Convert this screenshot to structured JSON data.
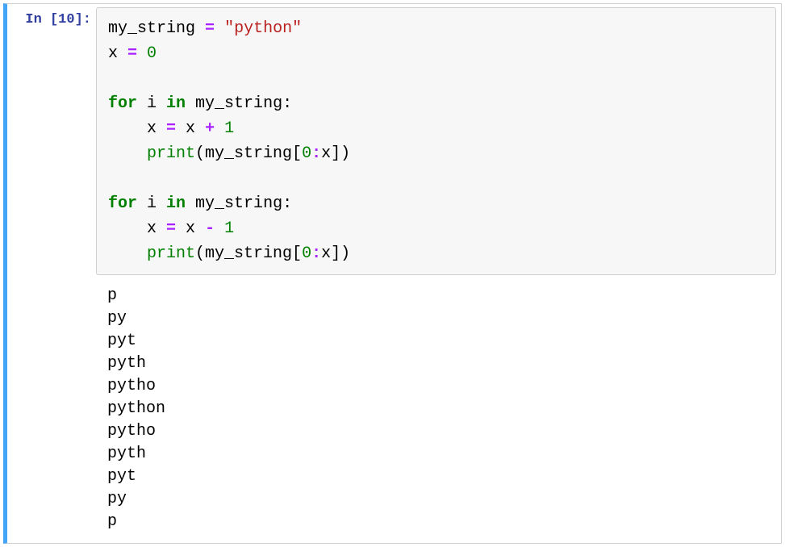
{
  "cell": {
    "prompt_label": "In [10]:",
    "code": {
      "l1": {
        "a": "my_string ",
        "op": "=",
        "b": " ",
        "str": "\"python\""
      },
      "l2": {
        "a": "x ",
        "op": "=",
        "b": " ",
        "num": "0"
      },
      "l3": "",
      "l4": {
        "kw1": "for",
        "a": " i ",
        "kw2": "in",
        "b": " my_string:"
      },
      "l5": {
        "indent": "    ",
        "a": "x ",
        "op1": "=",
        "b": " x ",
        "op2": "+",
        "c": " ",
        "num": "1"
      },
      "l6": {
        "indent": "    ",
        "fn": "print",
        "open": "(my_string[",
        "num0": "0",
        "slice": ":",
        "x": "x",
        "close": "])"
      },
      "l7": "",
      "l8": {
        "kw1": "for",
        "a": " i ",
        "kw2": "in",
        "b": " my_string:"
      },
      "l9": {
        "indent": "    ",
        "a": "x ",
        "op1": "=",
        "b": " x ",
        "op2": "-",
        "c": " ",
        "num": "1"
      },
      "l10": {
        "indent": "    ",
        "fn": "print",
        "open": "(my_string[",
        "num0": "0",
        "slice": ":",
        "x": "x",
        "close": "])"
      }
    },
    "output_lines": [
      "p",
      "py",
      "pyt",
      "pyth",
      "pytho",
      "python",
      "pytho",
      "pyth",
      "pyt",
      "py",
      "p"
    ]
  }
}
